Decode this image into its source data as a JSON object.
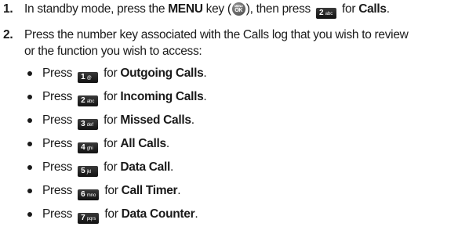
{
  "steps": [
    {
      "number": "1.",
      "text_before": "In standby mode, press the ",
      "menu_word": "MENU",
      "text_key": " key (",
      "menu_icon": {
        "top": "MENU",
        "bottom": "OK"
      },
      "text_then": "), then press ",
      "key": {
        "digit": "2",
        "letters": "abc"
      },
      "text_for": " for ",
      "target": "Calls",
      "text_end": "."
    },
    {
      "number": "2.",
      "line1": "Press the number key associated with the Calls log that you wish to review",
      "line2": "or the function you wish to access:"
    }
  ],
  "bullets": [
    {
      "press": "Press",
      "digit": "1",
      "letters": "@",
      "for": "for",
      "label": "Outgoing Calls",
      "end": "."
    },
    {
      "press": "Press",
      "digit": "2",
      "letters": "abc",
      "for": "for",
      "label": "Incoming Calls",
      "end": "."
    },
    {
      "press": "Press",
      "digit": "3",
      "letters": "def",
      "for": "for",
      "label": "Missed Calls",
      "end": "."
    },
    {
      "press": "Press",
      "digit": "4",
      "letters": "ghi",
      "for": "for",
      "label": "All Calls",
      "end": "."
    },
    {
      "press": "Press",
      "digit": "5",
      "letters": "jkl",
      "for": "for",
      "label": "Data Call",
      "end": "."
    },
    {
      "press": "Press",
      "digit": "6",
      "letters": "mno",
      "for": "for",
      "label": "Call Timer",
      "end": "."
    },
    {
      "press": "Press",
      "digit": "7",
      "letters": "pqrs",
      "for": "for",
      "label": "Data Counter",
      "end": "."
    }
  ]
}
